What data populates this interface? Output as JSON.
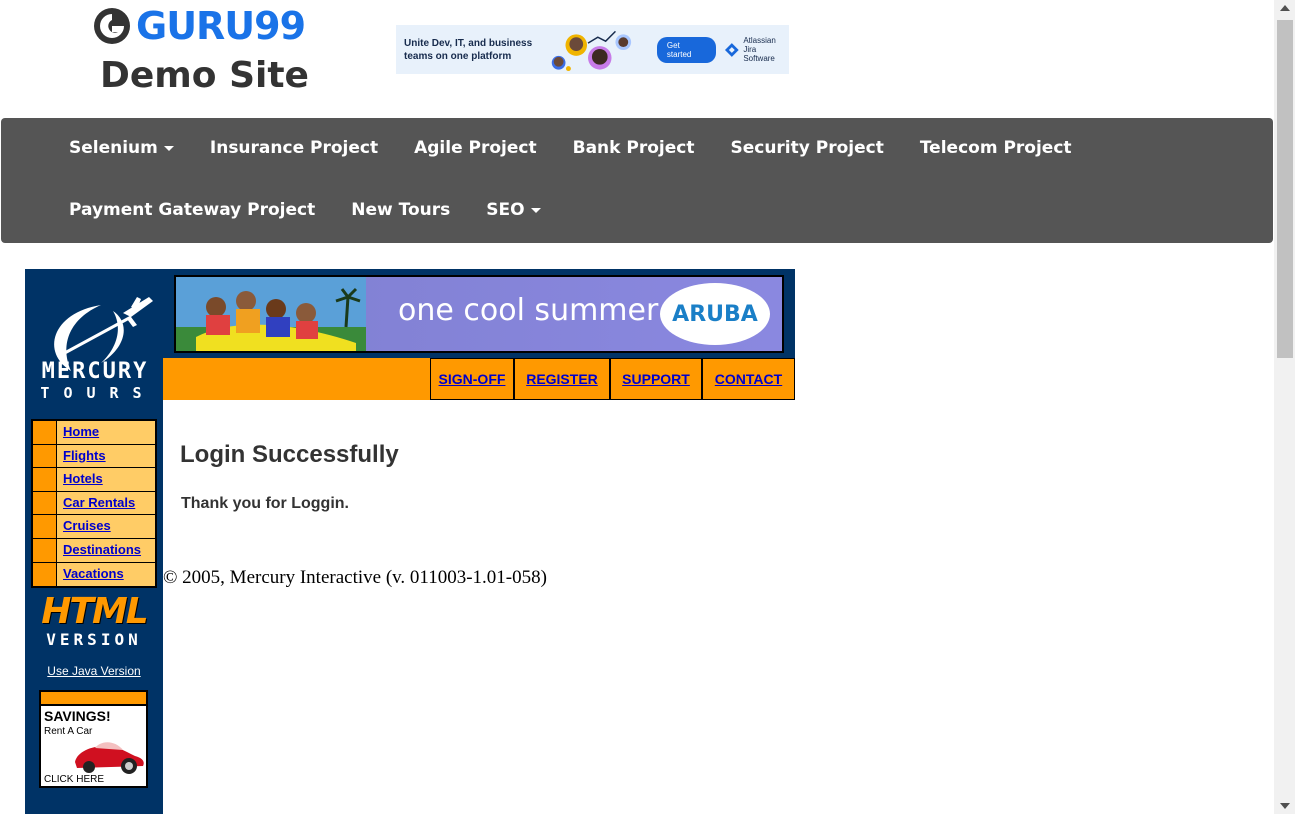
{
  "header": {
    "logo_text": "GURU99",
    "site_title": "Demo Site"
  },
  "ad": {
    "text": "Unite Dev, IT, and business teams on one platform",
    "button": "Get started",
    "brand_line1": "Atlassian",
    "brand_line2": "Jira Software"
  },
  "navbar": {
    "row1": [
      {
        "label": "Selenium",
        "dropdown": true
      },
      {
        "label": "Insurance Project"
      },
      {
        "label": "Agile Project"
      },
      {
        "label": "Bank Project"
      },
      {
        "label": "Security Project"
      },
      {
        "label": "Telecom Project"
      }
    ],
    "row2": [
      {
        "label": "Payment Gateway Project"
      },
      {
        "label": "New Tours"
      },
      {
        "label": "SEO",
        "dropdown": true
      }
    ]
  },
  "mercury": {
    "logo_line1": "MERCURY",
    "logo_line2": "TOURS",
    "banner_text": "one cool summer",
    "banner_brand": "ARUBA",
    "top_links": [
      "SIGN-OFF",
      "REGISTER",
      "SUPPORT",
      "CONTACT"
    ],
    "side_menu": [
      "Home",
      "Flights",
      "Hotels",
      "Car Rentals",
      "Cruises",
      "Destinations",
      "Vacations"
    ],
    "html_version_big": "HTML",
    "html_version_small": "VERSION",
    "java_link": "Use Java Version",
    "savings_title": "SAVINGS!",
    "savings_sub": "Rent A Car",
    "savings_click": "CLICK HERE"
  },
  "content": {
    "title": "Login Successfully",
    "message": "Thank you for Loggin.",
    "copyright": "© 2005, Mercury Interactive (v. 011003-1.01-058)"
  },
  "colors": {
    "navbar_bg": "#555555",
    "mercury_blue": "#003366",
    "orange": "#ff9900",
    "link_blue": "#0000cc",
    "guru_blue": "#1a73e8"
  }
}
